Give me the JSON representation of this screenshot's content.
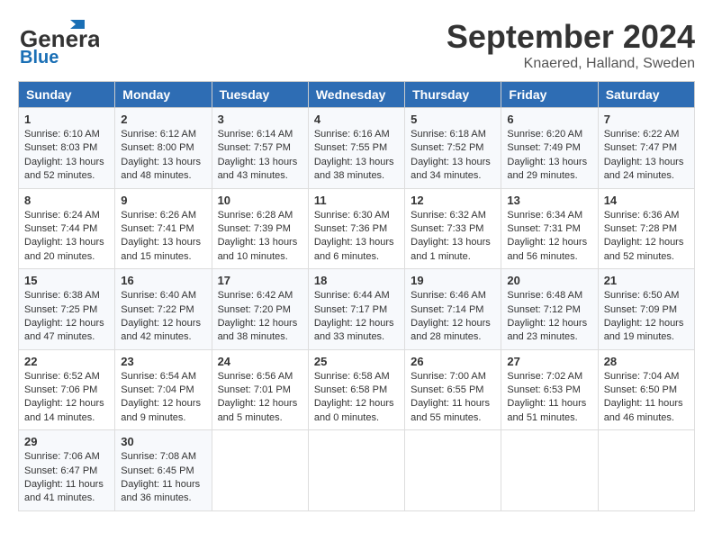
{
  "header": {
    "logo_general": "General",
    "logo_blue": "Blue",
    "month": "September 2024",
    "location": "Knaered, Halland, Sweden"
  },
  "weekdays": [
    "Sunday",
    "Monday",
    "Tuesday",
    "Wednesday",
    "Thursday",
    "Friday",
    "Saturday"
  ],
  "weeks": [
    [
      {
        "day": "1",
        "lines": [
          "Sunrise: 6:10 AM",
          "Sunset: 8:03 PM",
          "Daylight: 13 hours",
          "and 52 minutes."
        ]
      },
      {
        "day": "2",
        "lines": [
          "Sunrise: 6:12 AM",
          "Sunset: 8:00 PM",
          "Daylight: 13 hours",
          "and 48 minutes."
        ]
      },
      {
        "day": "3",
        "lines": [
          "Sunrise: 6:14 AM",
          "Sunset: 7:57 PM",
          "Daylight: 13 hours",
          "and 43 minutes."
        ]
      },
      {
        "day": "4",
        "lines": [
          "Sunrise: 6:16 AM",
          "Sunset: 7:55 PM",
          "Daylight: 13 hours",
          "and 38 minutes."
        ]
      },
      {
        "day": "5",
        "lines": [
          "Sunrise: 6:18 AM",
          "Sunset: 7:52 PM",
          "Daylight: 13 hours",
          "and 34 minutes."
        ]
      },
      {
        "day": "6",
        "lines": [
          "Sunrise: 6:20 AM",
          "Sunset: 7:49 PM",
          "Daylight: 13 hours",
          "and 29 minutes."
        ]
      },
      {
        "day": "7",
        "lines": [
          "Sunrise: 6:22 AM",
          "Sunset: 7:47 PM",
          "Daylight: 13 hours",
          "and 24 minutes."
        ]
      }
    ],
    [
      {
        "day": "8",
        "lines": [
          "Sunrise: 6:24 AM",
          "Sunset: 7:44 PM",
          "Daylight: 13 hours",
          "and 20 minutes."
        ]
      },
      {
        "day": "9",
        "lines": [
          "Sunrise: 6:26 AM",
          "Sunset: 7:41 PM",
          "Daylight: 13 hours",
          "and 15 minutes."
        ]
      },
      {
        "day": "10",
        "lines": [
          "Sunrise: 6:28 AM",
          "Sunset: 7:39 PM",
          "Daylight: 13 hours",
          "and 10 minutes."
        ]
      },
      {
        "day": "11",
        "lines": [
          "Sunrise: 6:30 AM",
          "Sunset: 7:36 PM",
          "Daylight: 13 hours",
          "and 6 minutes."
        ]
      },
      {
        "day": "12",
        "lines": [
          "Sunrise: 6:32 AM",
          "Sunset: 7:33 PM",
          "Daylight: 13 hours",
          "and 1 minute."
        ]
      },
      {
        "day": "13",
        "lines": [
          "Sunrise: 6:34 AM",
          "Sunset: 7:31 PM",
          "Daylight: 12 hours",
          "and 56 minutes."
        ]
      },
      {
        "day": "14",
        "lines": [
          "Sunrise: 6:36 AM",
          "Sunset: 7:28 PM",
          "Daylight: 12 hours",
          "and 52 minutes."
        ]
      }
    ],
    [
      {
        "day": "15",
        "lines": [
          "Sunrise: 6:38 AM",
          "Sunset: 7:25 PM",
          "Daylight: 12 hours",
          "and 47 minutes."
        ]
      },
      {
        "day": "16",
        "lines": [
          "Sunrise: 6:40 AM",
          "Sunset: 7:22 PM",
          "Daylight: 12 hours",
          "and 42 minutes."
        ]
      },
      {
        "day": "17",
        "lines": [
          "Sunrise: 6:42 AM",
          "Sunset: 7:20 PM",
          "Daylight: 12 hours",
          "and 38 minutes."
        ]
      },
      {
        "day": "18",
        "lines": [
          "Sunrise: 6:44 AM",
          "Sunset: 7:17 PM",
          "Daylight: 12 hours",
          "and 33 minutes."
        ]
      },
      {
        "day": "19",
        "lines": [
          "Sunrise: 6:46 AM",
          "Sunset: 7:14 PM",
          "Daylight: 12 hours",
          "and 28 minutes."
        ]
      },
      {
        "day": "20",
        "lines": [
          "Sunrise: 6:48 AM",
          "Sunset: 7:12 PM",
          "Daylight: 12 hours",
          "and 23 minutes."
        ]
      },
      {
        "day": "21",
        "lines": [
          "Sunrise: 6:50 AM",
          "Sunset: 7:09 PM",
          "Daylight: 12 hours",
          "and 19 minutes."
        ]
      }
    ],
    [
      {
        "day": "22",
        "lines": [
          "Sunrise: 6:52 AM",
          "Sunset: 7:06 PM",
          "Daylight: 12 hours",
          "and 14 minutes."
        ]
      },
      {
        "day": "23",
        "lines": [
          "Sunrise: 6:54 AM",
          "Sunset: 7:04 PM",
          "Daylight: 12 hours",
          "and 9 minutes."
        ]
      },
      {
        "day": "24",
        "lines": [
          "Sunrise: 6:56 AM",
          "Sunset: 7:01 PM",
          "Daylight: 12 hours",
          "and 5 minutes."
        ]
      },
      {
        "day": "25",
        "lines": [
          "Sunrise: 6:58 AM",
          "Sunset: 6:58 PM",
          "Daylight: 12 hours",
          "and 0 minutes."
        ]
      },
      {
        "day": "26",
        "lines": [
          "Sunrise: 7:00 AM",
          "Sunset: 6:55 PM",
          "Daylight: 11 hours",
          "and 55 minutes."
        ]
      },
      {
        "day": "27",
        "lines": [
          "Sunrise: 7:02 AM",
          "Sunset: 6:53 PM",
          "Daylight: 11 hours",
          "and 51 minutes."
        ]
      },
      {
        "day": "28",
        "lines": [
          "Sunrise: 7:04 AM",
          "Sunset: 6:50 PM",
          "Daylight: 11 hours",
          "and 46 minutes."
        ]
      }
    ],
    [
      {
        "day": "29",
        "lines": [
          "Sunrise: 7:06 AM",
          "Sunset: 6:47 PM",
          "Daylight: 11 hours",
          "and 41 minutes."
        ]
      },
      {
        "day": "30",
        "lines": [
          "Sunrise: 7:08 AM",
          "Sunset: 6:45 PM",
          "Daylight: 11 hours",
          "and 36 minutes."
        ]
      },
      {
        "day": "",
        "lines": []
      },
      {
        "day": "",
        "lines": []
      },
      {
        "day": "",
        "lines": []
      },
      {
        "day": "",
        "lines": []
      },
      {
        "day": "",
        "lines": []
      }
    ]
  ]
}
